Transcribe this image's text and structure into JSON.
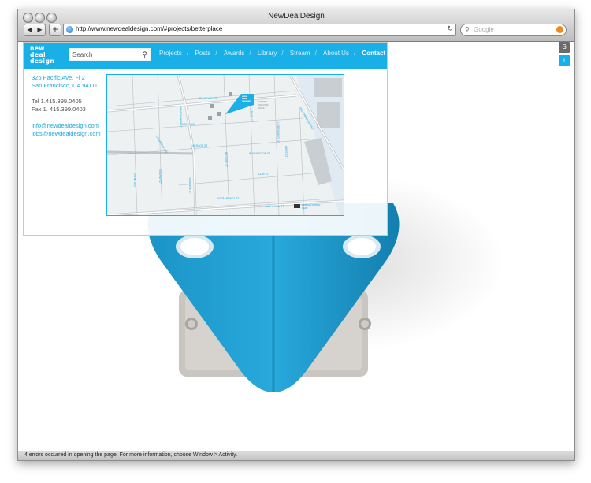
{
  "window": {
    "title": "NewDealDesign",
    "url": "http://www.newdealdesign.com/#projects/betterplace",
    "search_placeholder": "Google",
    "status": "4 errors occurred in opening the page. For more information, choose Window > Activity."
  },
  "icons": {
    "back": "back-arrow-icon",
    "forward": "forward-arrow-icon",
    "add": "plus-icon",
    "globe": "globe-icon",
    "reload": "reload-icon",
    "search": "search-icon",
    "snapback": "snapback-icon"
  },
  "site": {
    "logo_lines": [
      "new",
      "deal",
      "design"
    ],
    "search_placeholder": "Search",
    "nav": [
      "Projects",
      "Posts",
      "Awards",
      "Library",
      "Stream",
      "About Us",
      "Contact"
    ],
    "nav_separator": "/",
    "active_nav": "Contact",
    "address": [
      "325 Pacific Ave. Fl 2",
      "San Francisco, CA 94111"
    ],
    "phone": [
      "Tel 1.415.399.0405",
      "Fax 1. 415.399.0403"
    ],
    "emails": [
      "info@newdealdesign.com",
      "jobs@newdealdesign.com"
    ]
  },
  "map": {
    "streets": {
      "broadway": "BROADWAY ST",
      "pacific": "PACIFIC AVE",
      "jackson": "JACKSON ST",
      "washington": "WASHINGTON ST",
      "clay": "CLAY ST",
      "sacramento": "SACRAMENTO ST",
      "california": "CALIFORNIA ST",
      "montgomery": "MONTGOMERY ST",
      "columbus": "COLUMBUS AVE",
      "kearny": "KEARNY ST",
      "grant": "GRANT AVE",
      "sansome": "SANSOME ST",
      "front": "FRONT ST",
      "battery": "BATTERY ST",
      "leidesdorff": "LEIDESDORFF ST",
      "davis": "DAVIS ST",
      "embarcadero": "THE EMBARCADERO"
    },
    "park": [
      "SIDNEY",
      "WALTON",
      "PARK"
    ],
    "marker_logo": [
      "new",
      "deal",
      "design"
    ],
    "station": [
      "EMBARCADERO",
      "BART"
    ],
    "colors": {
      "accent": "#19b0e8",
      "street_fill": "#ffffff",
      "street_stroke": "#b9bec2",
      "building": "#c9ced2",
      "bay": "#dfeaf2"
    }
  },
  "side_buttons": [
    "S",
    "i"
  ],
  "colors": {
    "accent": "#19b0e8",
    "product_blue": "#1e9fd2",
    "side_dark": "#6b6b6b"
  }
}
